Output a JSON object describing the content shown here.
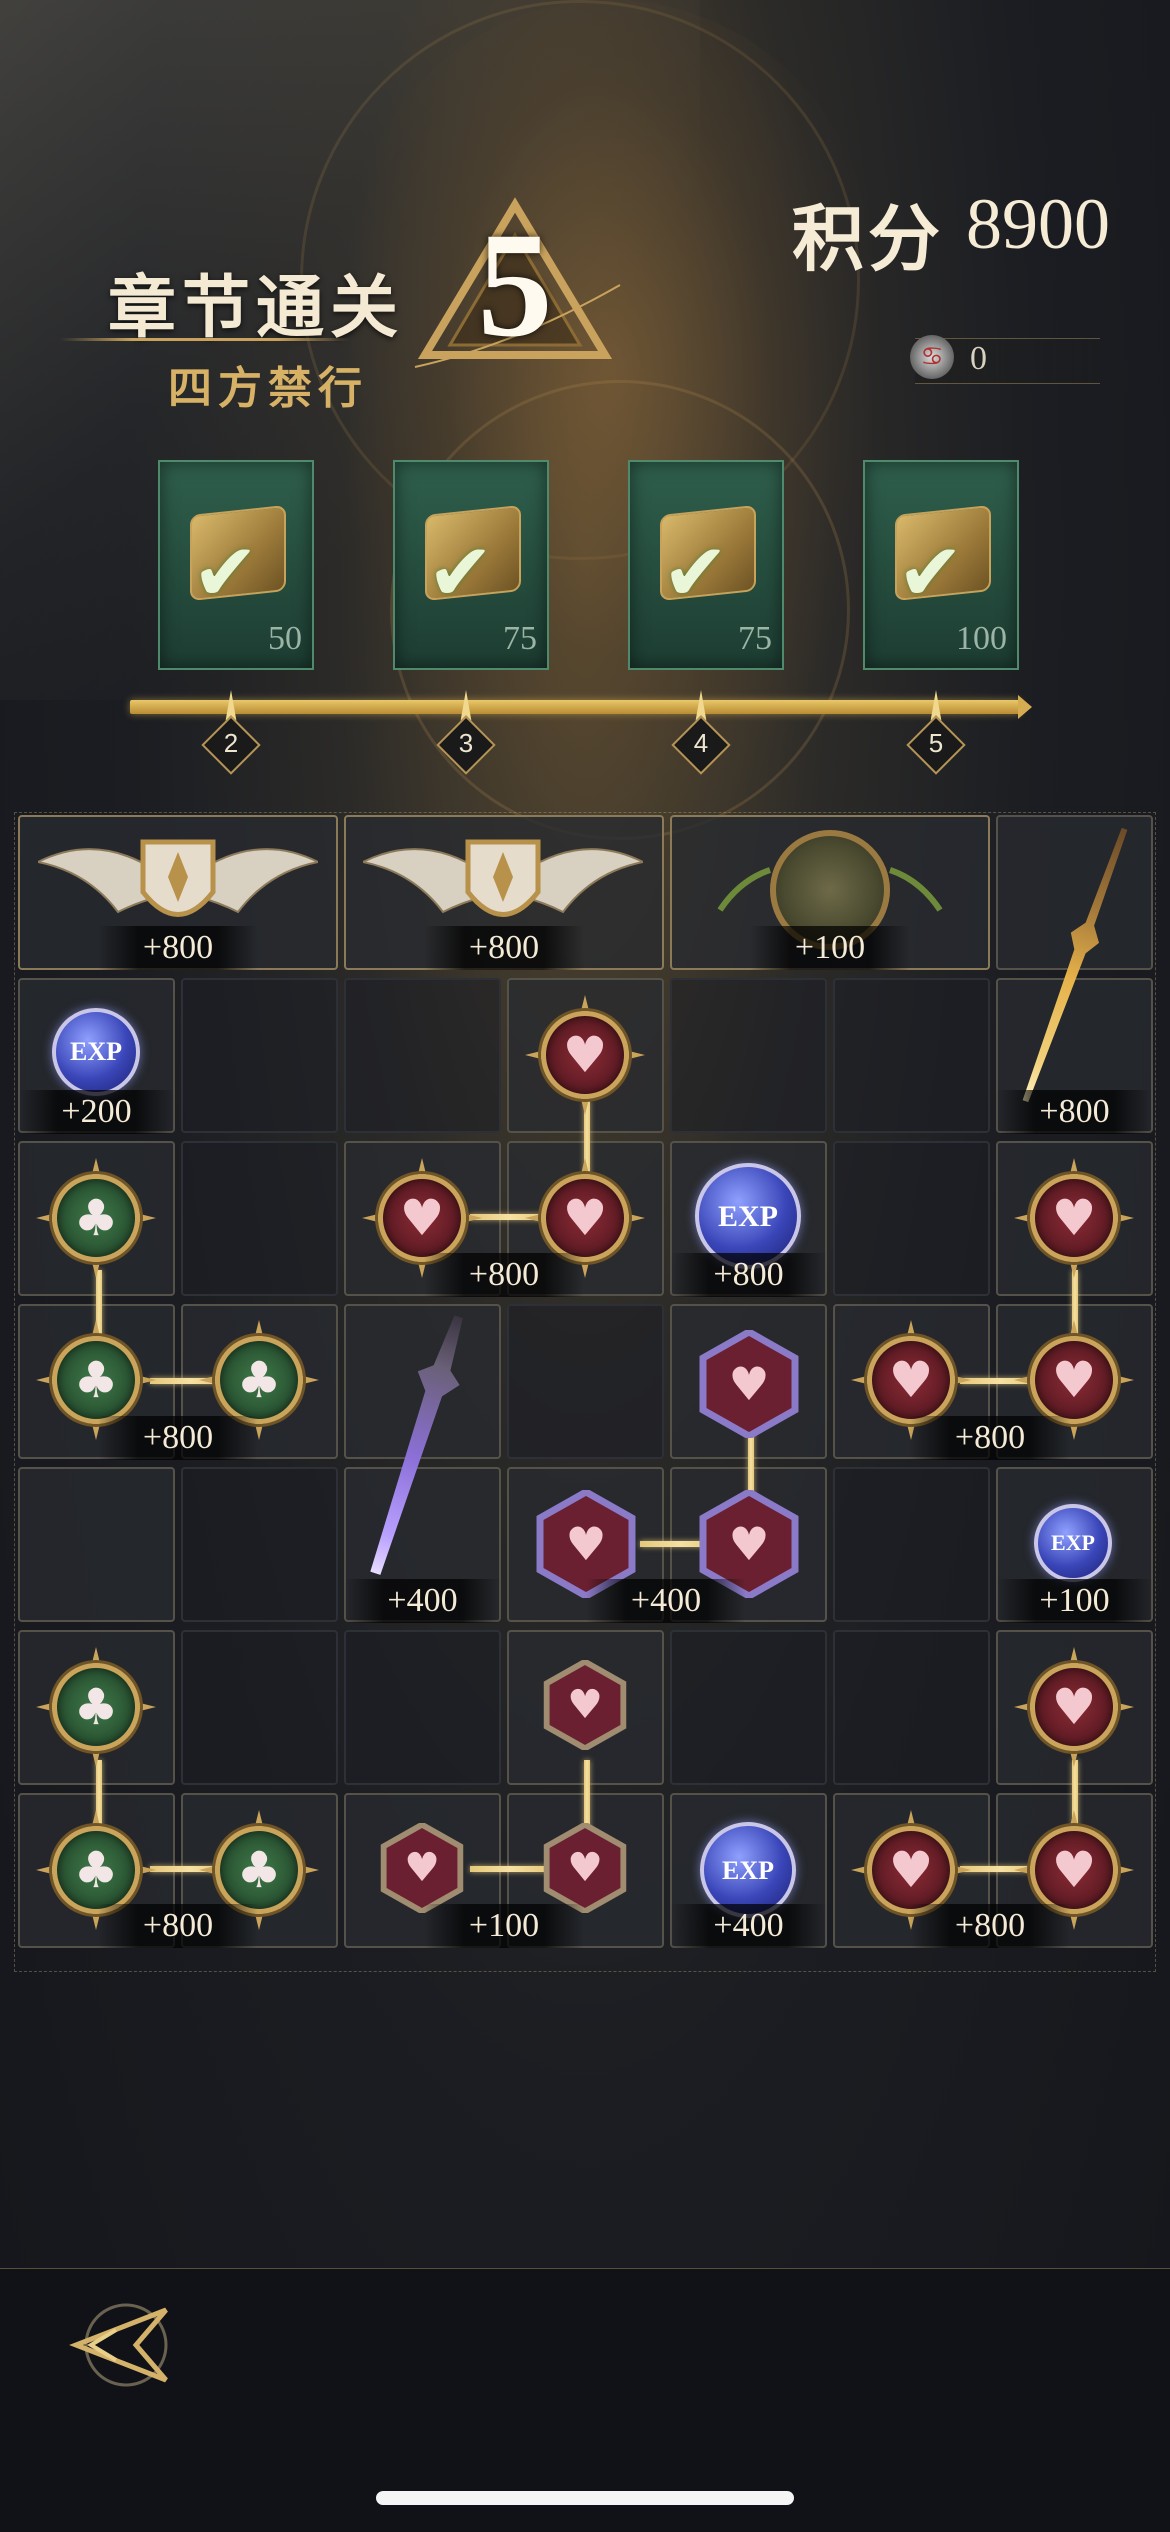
{
  "header": {
    "chapter_label": "章节通关",
    "chapter_number": "5",
    "chapter_name": "四方禁行",
    "score_label": "积分",
    "score_value": "8900",
    "currency_value": "0"
  },
  "milestones": [
    {
      "points": "50",
      "marker": "2",
      "completed": true
    },
    {
      "points": "75",
      "marker": "3",
      "completed": true
    },
    {
      "points": "75",
      "marker": "4",
      "completed": true
    },
    {
      "points": "100",
      "marker": "5",
      "completed": true
    }
  ],
  "board": {
    "rewards": {
      "r1_a": "+800",
      "r1_b": "+800",
      "r1_c": "+100",
      "r2_exp": "+200",
      "r2_dagger": "+800",
      "r3_hearts": "+800",
      "r3_exp": "+800",
      "r4_clubs": "+800",
      "r4_hearts": "+800",
      "r5_dagger": "+400",
      "r5_hearts": "+400",
      "r5_exp": "+100",
      "r7_clubs": "+800",
      "r7_hearts": "+100",
      "r7_exp": "+400",
      "r7_right_hearts": "+800"
    },
    "exp_label": "EXP"
  },
  "icons": {
    "club": "♣",
    "heart": "♥",
    "check": "✔"
  },
  "colors": {
    "gold": "#c9a45a",
    "club_green": "#3f7a48",
    "heart_red": "#8a2a35",
    "chest_green": "#2f5f4c"
  }
}
